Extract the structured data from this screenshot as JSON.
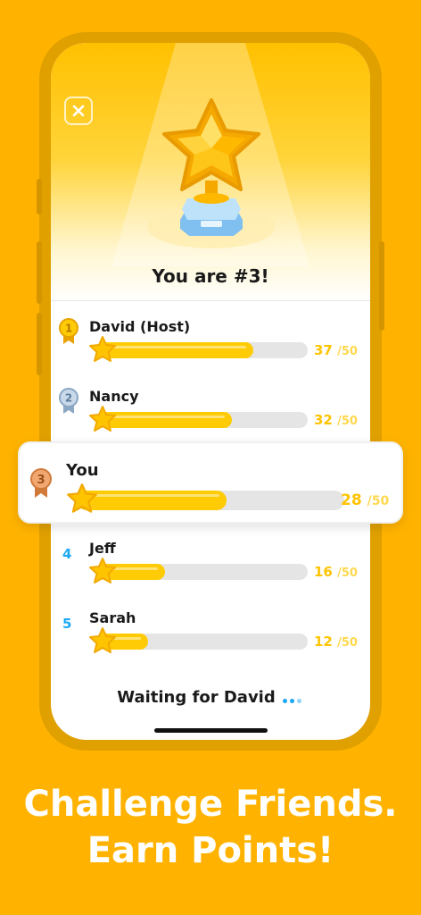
{
  "screen": {
    "title": "You are #3!",
    "close_icon": "close-icon",
    "waiting_text": "Waiting for David"
  },
  "leaderboard": [
    {
      "rank": "1",
      "name": "David (Host)",
      "score": "37",
      "max": "/50",
      "value": 37
    },
    {
      "rank": "2",
      "name": "Nancy",
      "score": "32",
      "max": "/50",
      "value": 32
    },
    {
      "rank": "3",
      "name": "You",
      "score": "28",
      "max": "/50",
      "value": 28
    },
    {
      "rank": "4",
      "name": "Jeff",
      "score": "16",
      "max": "/50",
      "value": 16
    },
    {
      "rank": "5",
      "name": "Sarah",
      "score": "12",
      "max": "/50",
      "value": 12
    }
  ],
  "marketing": {
    "line1": "Challenge Friends.",
    "line2": "Earn Points!"
  },
  "colors": {
    "background": "#FFB300",
    "bar_fill": "#FFCB05",
    "rank_blue": "#1CA8F5"
  }
}
